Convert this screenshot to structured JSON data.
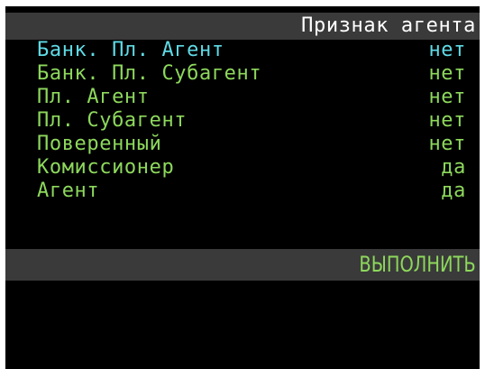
{
  "header": {
    "title": "Признак агента"
  },
  "items": [
    {
      "label": "Банк. Пл. Агент",
      "value": "нет"
    },
    {
      "label": "Банк. Пл. Субагент",
      "value": "нет"
    },
    {
      "label": "Пл. Агент",
      "value": "нет"
    },
    {
      "label": "Пл. Субагент",
      "value": "нет"
    },
    {
      "label": "Поверенный",
      "value": "нет"
    },
    {
      "label": "Комиссионер",
      "value": "да"
    },
    {
      "label": "Агент",
      "value": "да"
    }
  ],
  "action": {
    "label": "ВЫПОЛНИТЬ"
  },
  "colors": {
    "background": "#000000",
    "bar": "#3a3a3a",
    "text_normal": "#8dd85c",
    "text_selected": "#5fdbe6",
    "title_text": "#ffffff"
  }
}
